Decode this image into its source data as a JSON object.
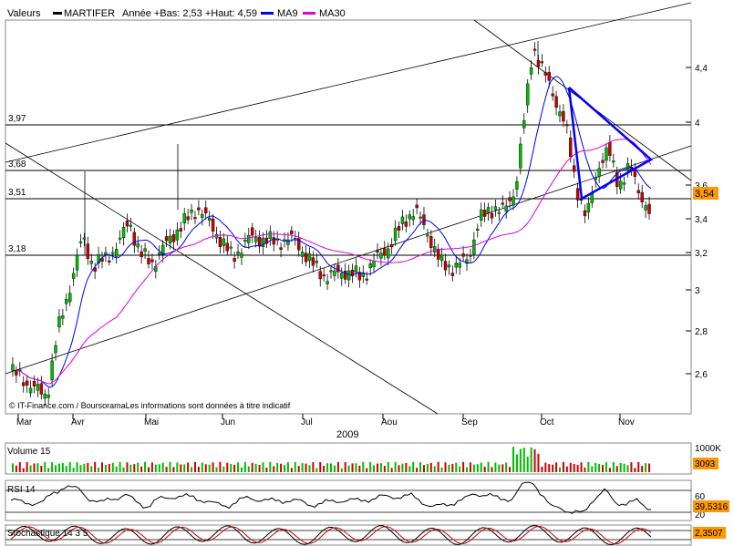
{
  "legend": {
    "valeurs": "Valeurs",
    "symbol": "MARTIFER",
    "info": "Année +Bas: 2,53 +Haut: 4,59",
    "ma9": "MA9",
    "ma30": "MA30"
  },
  "source_note": "© IT-Finance.com / BoursoramaLes informations sont données à titre indicatif",
  "year_label": "2009",
  "colors": {
    "up": "#00bb00",
    "down": "#cc0000",
    "ma9": "#0000ee",
    "ma30": "#dd00dd",
    "triangle": "#0000ff",
    "last_badge": "#ff9900"
  },
  "chart_data": [
    {
      "type": "candlestick",
      "title": "",
      "x_tick_labels": [
        "Mar",
        "Avr",
        "Mai",
        "Jun",
        "Jul",
        "Aou",
        "Sep",
        "Oct",
        "Nov"
      ],
      "y_ticks": [
        "2,6",
        "2,8",
        "3",
        "3,2",
        "3,4",
        "3,6",
        "4",
        "4,4"
      ],
      "ylim": [
        2.43,
        4.7
      ],
      "level_lines": [
        {
          "value": 3.97,
          "label": "3,97"
        },
        {
          "value": 3.68,
          "label": "3,68"
        },
        {
          "value": 3.51,
          "label": "3,51"
        },
        {
          "value": 3.18,
          "label": "3,18"
        }
      ],
      "last_value": "3,54",
      "series": [
        {
          "name": "MA9",
          "type": "line"
        },
        {
          "name": "MA30",
          "type": "line"
        }
      ],
      "notes": "Daily candlesticks from March to mid-November 2009; low 2,53 near end of March, high 4,59 late September; symmetrical triangle drawn in Oct–Nov; long ascending and descending trend channels."
    },
    {
      "type": "bar",
      "title": "Volume 15",
      "y_ticks": [
        "1000K"
      ],
      "last_value": "3093"
    },
    {
      "type": "line",
      "title": "RSI 14",
      "y_ticks": [
        "60",
        "20"
      ],
      "last_value": "39,5316"
    },
    {
      "type": "line",
      "title": "Stochastique 14 3 5",
      "last_value": "2,3507"
    }
  ]
}
